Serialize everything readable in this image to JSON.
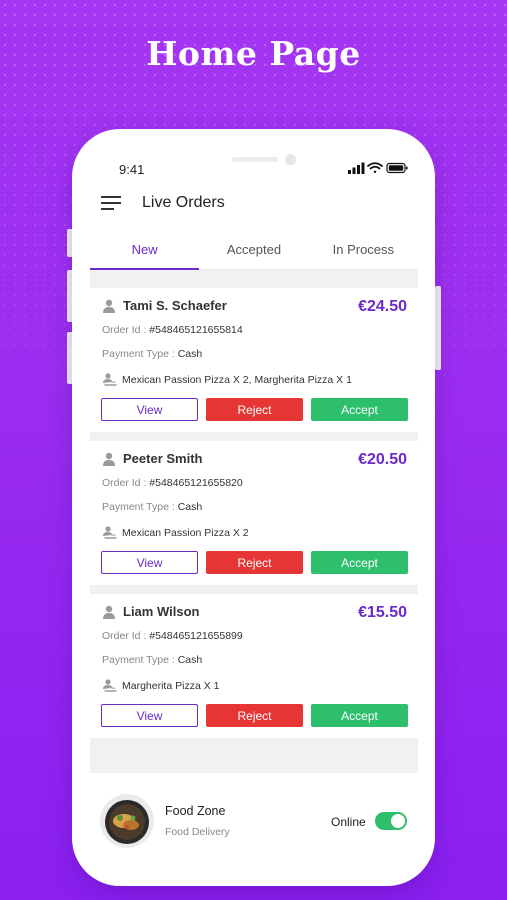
{
  "headline": "Home Page",
  "status_bar": {
    "time": "9:41"
  },
  "header": {
    "title": "Live Orders",
    "menu_icon": "hamburger-icon"
  },
  "tabs": [
    {
      "label": "New",
      "active": true
    },
    {
      "label": "Accepted",
      "active": false
    },
    {
      "label": "In Process",
      "active": false
    }
  ],
  "orders": [
    {
      "name": "Tami S. Schaefer",
      "price": "€24.50",
      "order_id_label": "Order Id :",
      "order_id": "#548465121655814",
      "payment_label": "Payment Type :",
      "payment": "Cash",
      "items": "Mexican Passion Pizza X 2, Margherita Pizza X 1"
    },
    {
      "name": "Peeter Smith",
      "price": "€20.50",
      "order_id_label": "Order Id :",
      "order_id": "#548465121655820",
      "payment_label": "Payment Type :",
      "payment": "Cash",
      "items": "Mexican Passion Pizza X 2"
    },
    {
      "name": "Liam Wilson",
      "price": "€15.50",
      "order_id_label": "Order Id :",
      "order_id": "#548465121655899",
      "payment_label": "Payment Type :",
      "payment": "Cash",
      "items": "Margherita Pizza X 1"
    }
  ],
  "buttons": {
    "view": "View",
    "reject": "Reject",
    "accept": "Accept"
  },
  "footer": {
    "store_name": "Food Zone",
    "store_type": "Food Delivery",
    "status_label": "Online",
    "online": true
  },
  "colors": {
    "accent": "#6a2bc9",
    "reject": "#e63535",
    "accept": "#2dbf6c",
    "background": "#9a2cf0"
  }
}
